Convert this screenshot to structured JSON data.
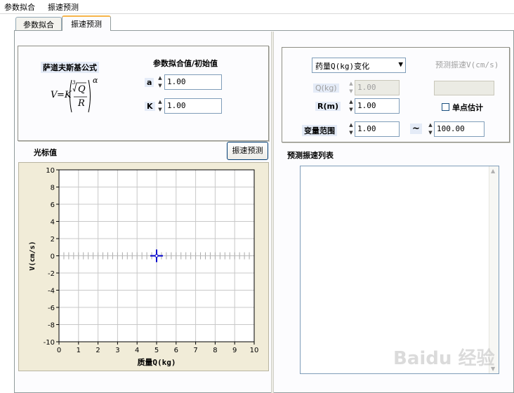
{
  "menu": [
    "参数拟合",
    "振速预测"
  ],
  "tabs": [
    {
      "label": "参数拟合",
      "active": false
    },
    {
      "label": "振速预测",
      "active": true
    }
  ],
  "left_group": {
    "formula_title": "萨道夫斯基公式",
    "formula": {
      "V": "V",
      "eq": "=K",
      "Q": "Q",
      "R": "R",
      "alpha": "α",
      "root": "3"
    },
    "params_title": "参数拟合值/初始值",
    "a_label": "a",
    "a_value": "1.00",
    "k_label": "K",
    "k_value": "1.00"
  },
  "cursor_label": "光标值",
  "predict_button": "振速预测",
  "right_group": {
    "mode_select": "药量Q(kg)变化",
    "predicted_label": "预测振速V(cm/s)",
    "predicted_value": "",
    "q_label": "Q(kg)",
    "q_value": "1.00",
    "r_label": "R(m)",
    "r_value": "1.00",
    "single_point_label": "单点估计",
    "single_point_checked": false,
    "range_label": "变量范围",
    "range_min": "1.00",
    "range_sep": "~",
    "range_max": "100.00"
  },
  "list_title": "预测振速列表",
  "chart_data": {
    "type": "scatter",
    "xlabel": "质量Q(kg)",
    "ylabel": "V(cm/s)",
    "xlim": [
      0,
      10
    ],
    "ylim": [
      -10,
      10
    ],
    "xticks": [
      0,
      1,
      2,
      3,
      4,
      5,
      6,
      7,
      8,
      9,
      10
    ],
    "yticks": [
      -10,
      -8,
      -6,
      -4,
      -2,
      0,
      2,
      4,
      6,
      8,
      10
    ],
    "grid": true,
    "cursor": {
      "x": 5,
      "y": 0
    },
    "cursor_color": "#0000cc",
    "points": []
  },
  "watermark": "Baidu 经验"
}
